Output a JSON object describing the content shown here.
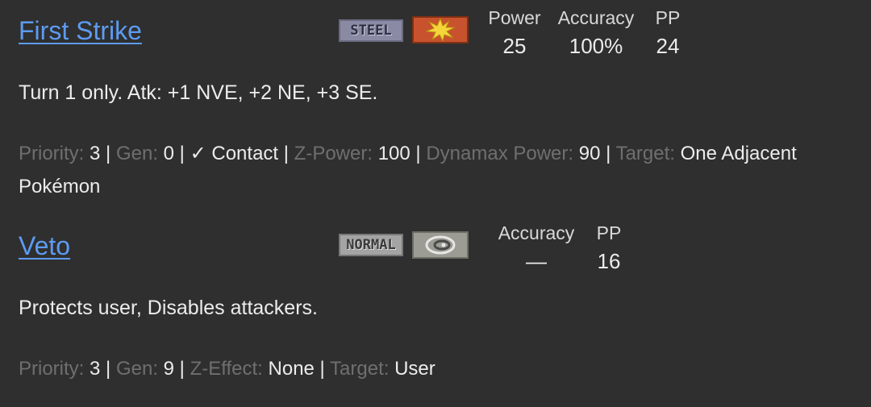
{
  "moves": [
    {
      "name": "First Strike",
      "type": "STEEL",
      "category_icon": "physical-burst-icon",
      "stats": {
        "power_label": "Power",
        "power": "25",
        "accuracy_label": "Accuracy",
        "accuracy": "100%",
        "pp_label": "PP",
        "pp": "24"
      },
      "description": "Turn 1 only. Atk: +1 NVE, +2 NE, +3 SE.",
      "details": {
        "priority_label": "Priority:",
        "priority": "3",
        "gen_label": "Gen:",
        "gen": "0",
        "contact": "✓ Contact",
        "zpower_label": "Z-Power:",
        "zpower": "100",
        "dynamax_label": "Dynamax Power:",
        "dynamax": "90",
        "target_label": "Target:",
        "target": "One Adjacent Pokémon"
      }
    },
    {
      "name": "Veto",
      "type": "NORMAL",
      "category_icon": "status-swirl-icon",
      "stats": {
        "accuracy_label": "Accuracy",
        "accuracy": "—",
        "pp_label": "PP",
        "pp": "16"
      },
      "description": "Protects user, Disables attackers.",
      "details": {
        "priority_label": "Priority:",
        "priority": "3",
        "gen_label": "Gen:",
        "gen": "9",
        "zeffect_label": "Z-Effect:",
        "zeffect": "None",
        "target_label": "Target:",
        "target": "User"
      }
    }
  ],
  "separator": " | ",
  "colors": {
    "background": "#2f2f2f",
    "link": "#5d9bf2",
    "dim": "#6f6f6f",
    "text": "#ececec"
  }
}
